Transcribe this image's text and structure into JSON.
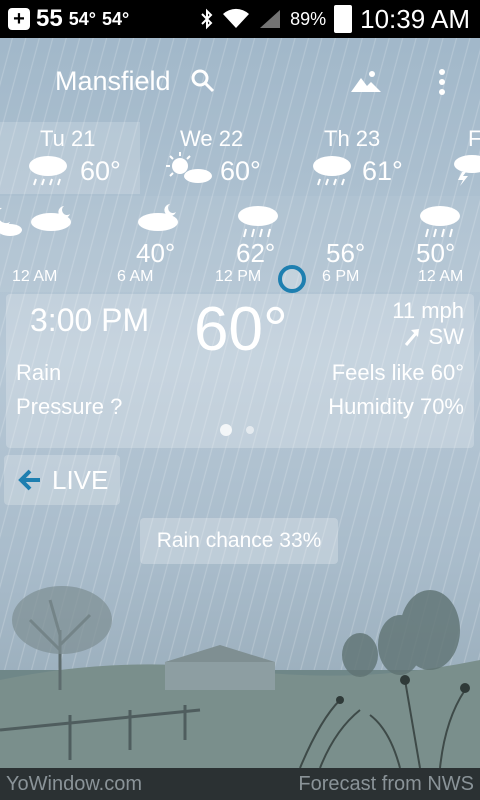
{
  "status_bar": {
    "temp_large": "55",
    "temp_1": "54°",
    "temp_2": "54°",
    "battery": "89%",
    "time": "10:39 AM"
  },
  "header": {
    "city": "Mansfield"
  },
  "days": [
    {
      "label": "Tu 21",
      "temp": "60°",
      "icon": "rain-cloud-icon"
    },
    {
      "label": "We 22",
      "temp": "60°",
      "icon": "sun-cloud-icon"
    },
    {
      "label": "Th 23",
      "temp": "61°",
      "icon": "rain-cloud-icon"
    },
    {
      "label": "F",
      "temp": "",
      "icon": "storm-cloud-icon"
    }
  ],
  "hours": [
    {
      "time": "12 AM",
      "temp": "",
      "icon": "moon-cloud-icon"
    },
    {
      "time": "6 AM",
      "temp": "40°",
      "icon": "moon-cloud-icon"
    },
    {
      "time": "12 PM",
      "temp": "62°",
      "icon": "rain-cloud-icon"
    },
    {
      "time": "6 PM",
      "temp": "56°",
      "icon": ""
    },
    {
      "time": "12 AM",
      "temp": "50°",
      "icon": "rain-cloud-icon"
    }
  ],
  "current": {
    "time": "3:00 PM",
    "temp": "60°",
    "wind_speed": "11 mph",
    "wind_dir": "SW",
    "condition": "Rain",
    "pressure": "Pressure ?",
    "feels_like": "Feels like 60°",
    "humidity": "Humidity 70%"
  },
  "live_label": "LIVE",
  "rain_chance": "Rain chance 33%",
  "footer": {
    "left": "YoWindow.com",
    "right": "Forecast from NWS"
  },
  "colors": {
    "now_ring": "#1e7fb0",
    "accent_arrow": "#1e7fb0"
  }
}
